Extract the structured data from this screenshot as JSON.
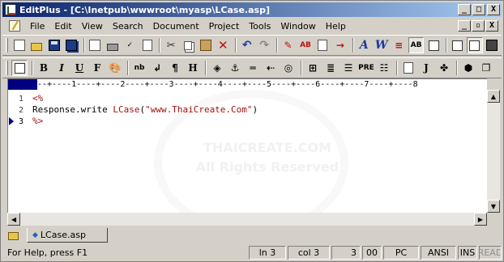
{
  "window": {
    "title": "EditPlus - [C:\\Inetpub\\wwwroot\\myasp\\LCase.asp]",
    "minimize": "_",
    "maximize": "□",
    "close": "X"
  },
  "menu": {
    "items": [
      "File",
      "Edit",
      "View",
      "Search",
      "Document",
      "Project",
      "Tools",
      "Window",
      "Help"
    ],
    "mdi_minimize": "_",
    "mdi_restore": "▫",
    "mdi_close": "X"
  },
  "toolbar_html": {
    "bold": "B",
    "italic": "I",
    "underline": "U",
    "font": "F",
    "nbsp": "nb",
    "pre": "PRE",
    "j": "J"
  },
  "ruler": {
    "text": "--+----1----+----2----+----3----+----4----+----5----+----6----+----7----+----8"
  },
  "editor": {
    "lines": [
      {
        "num": "1",
        "tokens": [
          {
            "t": "<%",
            "k": "delim"
          }
        ]
      },
      {
        "num": "2",
        "tokens": [
          {
            "t": "Response.write ",
            "k": "ident"
          },
          {
            "t": "LCase",
            "k": "func"
          },
          {
            "t": "(",
            "k": "ident"
          },
          {
            "t": "\"www.ThaiCreate.Com\"",
            "k": "str"
          },
          {
            "t": ")",
            "k": "ident"
          }
        ]
      },
      {
        "num": "3",
        "tokens": [
          {
            "t": "%>",
            "k": "delim"
          }
        ]
      }
    ],
    "current_line": 3,
    "watermark": [
      "THAICREATE.COM",
      "All Rights Reserved"
    ]
  },
  "tabs": {
    "active": "LCase.asp"
  },
  "status": {
    "help": "For Help, press F1",
    "ln": "ln 3",
    "col": "col 3",
    "num": "3",
    "code": "00",
    "platform": "PC",
    "encoding": "ANSI",
    "ins": "INS",
    "read": "READ"
  },
  "colors": {
    "title_gradient_start": "#0a246a",
    "title_gradient_end": "#a6caf0",
    "code_red": "#a01010",
    "cursor_marker": "#000080"
  }
}
